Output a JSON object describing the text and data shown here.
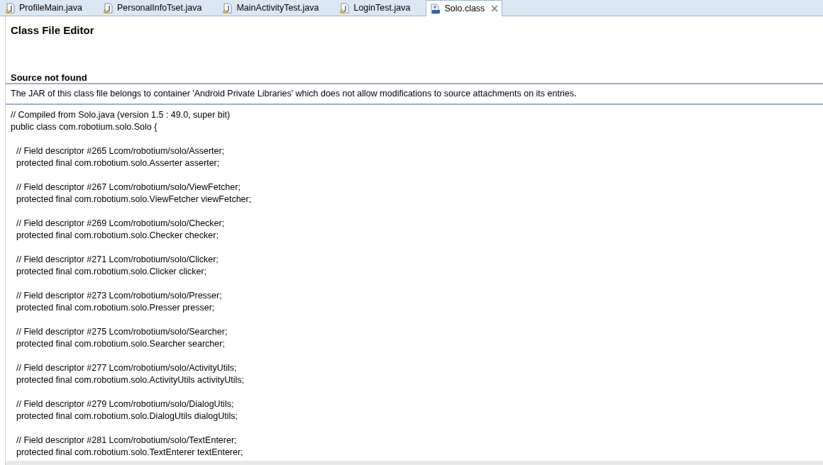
{
  "tabs": [
    {
      "label": "ProfileMain.java",
      "kind": "java",
      "selected": false
    },
    {
      "label": "PersonalInfoTset.java",
      "kind": "java",
      "selected": false
    },
    {
      "label": "MainActivityTest.java",
      "kind": "java",
      "selected": false
    },
    {
      "label": "LoginTest.java",
      "kind": "java",
      "selected": false
    },
    {
      "label": "Solo.class",
      "kind": "class",
      "selected": true
    }
  ],
  "editor": {
    "title": "Class File Editor",
    "section_title": "Source not found",
    "message": "The JAR of this class file belongs to container 'Android Private Libraries' which does not allow modifications to source attachments on its entries.",
    "header_lines": [
      "// Compiled from Solo.java (version 1.5 : 49.0, super bit)",
      "public class com.robotium.solo.Solo {"
    ],
    "fields": [
      {
        "comment": "// Field descriptor #265 Lcom/robotium/solo/Asserter;",
        "declaration": "protected final com.robotium.solo.Asserter asserter;"
      },
      {
        "comment": "// Field descriptor #267 Lcom/robotium/solo/ViewFetcher;",
        "declaration": "protected final com.robotium.solo.ViewFetcher viewFetcher;"
      },
      {
        "comment": "// Field descriptor #269 Lcom/robotium/solo/Checker;",
        "declaration": "protected final com.robotium.solo.Checker checker;"
      },
      {
        "comment": "// Field descriptor #271 Lcom/robotium/solo/Clicker;",
        "declaration": "protected final com.robotium.solo.Clicker clicker;"
      },
      {
        "comment": "// Field descriptor #273 Lcom/robotium/solo/Presser;",
        "declaration": "protected final com.robotium.solo.Presser presser;"
      },
      {
        "comment": "// Field descriptor #275 Lcom/robotium/solo/Searcher;",
        "declaration": "protected final com.robotium.solo.Searcher searcher;"
      },
      {
        "comment": "// Field descriptor #277 Lcom/robotium/solo/ActivityUtils;",
        "declaration": "protected final com.robotium.solo.ActivityUtils activityUtils;"
      },
      {
        "comment": "// Field descriptor #279 Lcom/robotium/solo/DialogUtils;",
        "declaration": "protected final com.robotium.solo.DialogUtils dialogUtils;"
      },
      {
        "comment": "// Field descriptor #281 Lcom/robotium/solo/TextEnterer;",
        "declaration": "protected final com.robotium.solo.TextEnterer textEnterer;"
      }
    ]
  }
}
